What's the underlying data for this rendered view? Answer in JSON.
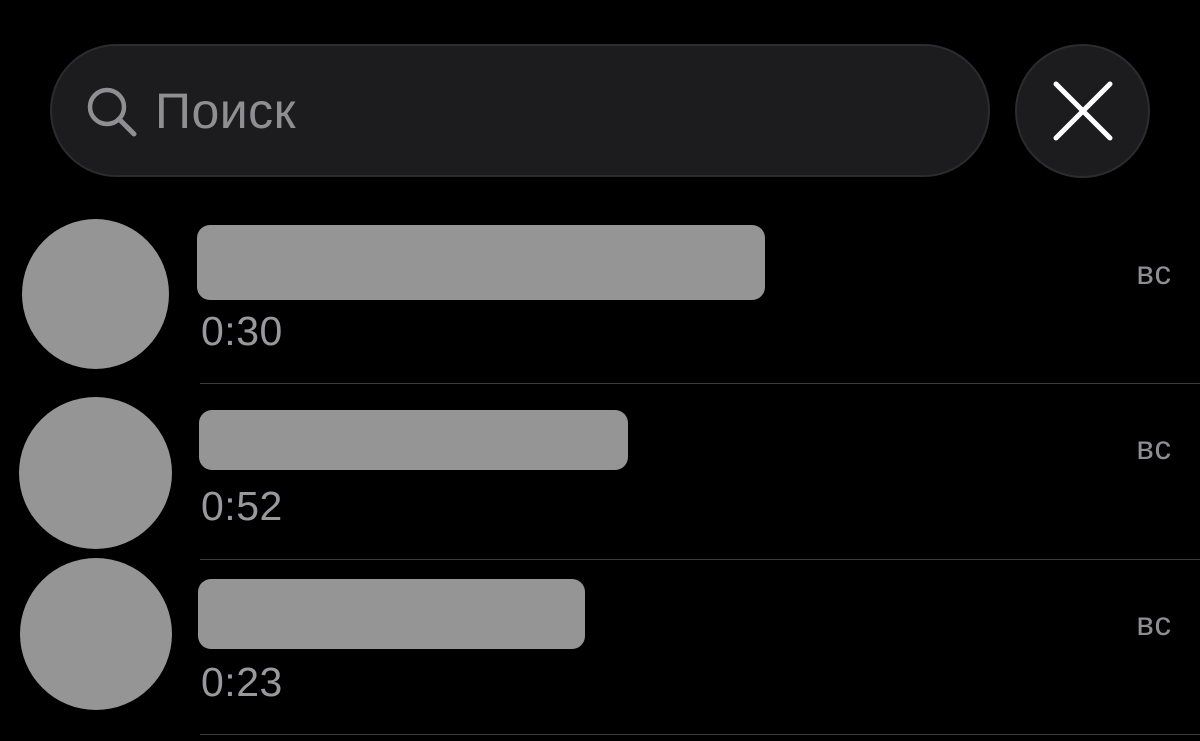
{
  "search": {
    "placeholder": "Поиск",
    "icon": "search-icon"
  },
  "close": {
    "icon": "close-icon"
  },
  "calls": [
    {
      "duration": "0:30",
      "day": "вс"
    },
    {
      "duration": "0:52",
      "day": "вс"
    },
    {
      "duration": "0:23",
      "day": "вс"
    }
  ],
  "colors": {
    "background": "#000000",
    "field": "#1c1c1e",
    "secondary_text": "#8e8e93",
    "redaction": "#959595"
  }
}
